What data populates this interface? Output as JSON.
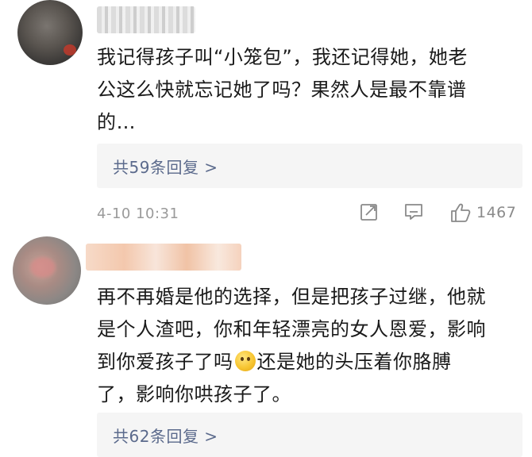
{
  "comments": [
    {
      "text_lines": [
        "我记得孩子叫“小笼包”，我还记得她，她老",
        "公这么快就忘记她了吗？果然人是最不靠谱",
        "的…"
      ],
      "replies_label": "共59条回复 >",
      "timestamp": "4-10 10:31",
      "like_count": "1467",
      "icons": [
        "share-icon",
        "comment-icon",
        "like-icon"
      ]
    },
    {
      "text_lines": [
        "再不再婚是他的选择，但是把孩子过继，他就",
        "是个人渣吧，你和年轻漂亮的女人恩爱，影响",
        "到你爱孩子了吗",
        "还是她的头压着你胳膊",
        "了，影响你哄孩子了。"
      ],
      "emoji_icon": "thinking-face-emoji",
      "replies_label": "共62条回复 >"
    }
  ],
  "colors": {
    "link": "#5b6a8c",
    "meta": "#9a9a9a",
    "reply_bg": "#f5f5f5"
  }
}
